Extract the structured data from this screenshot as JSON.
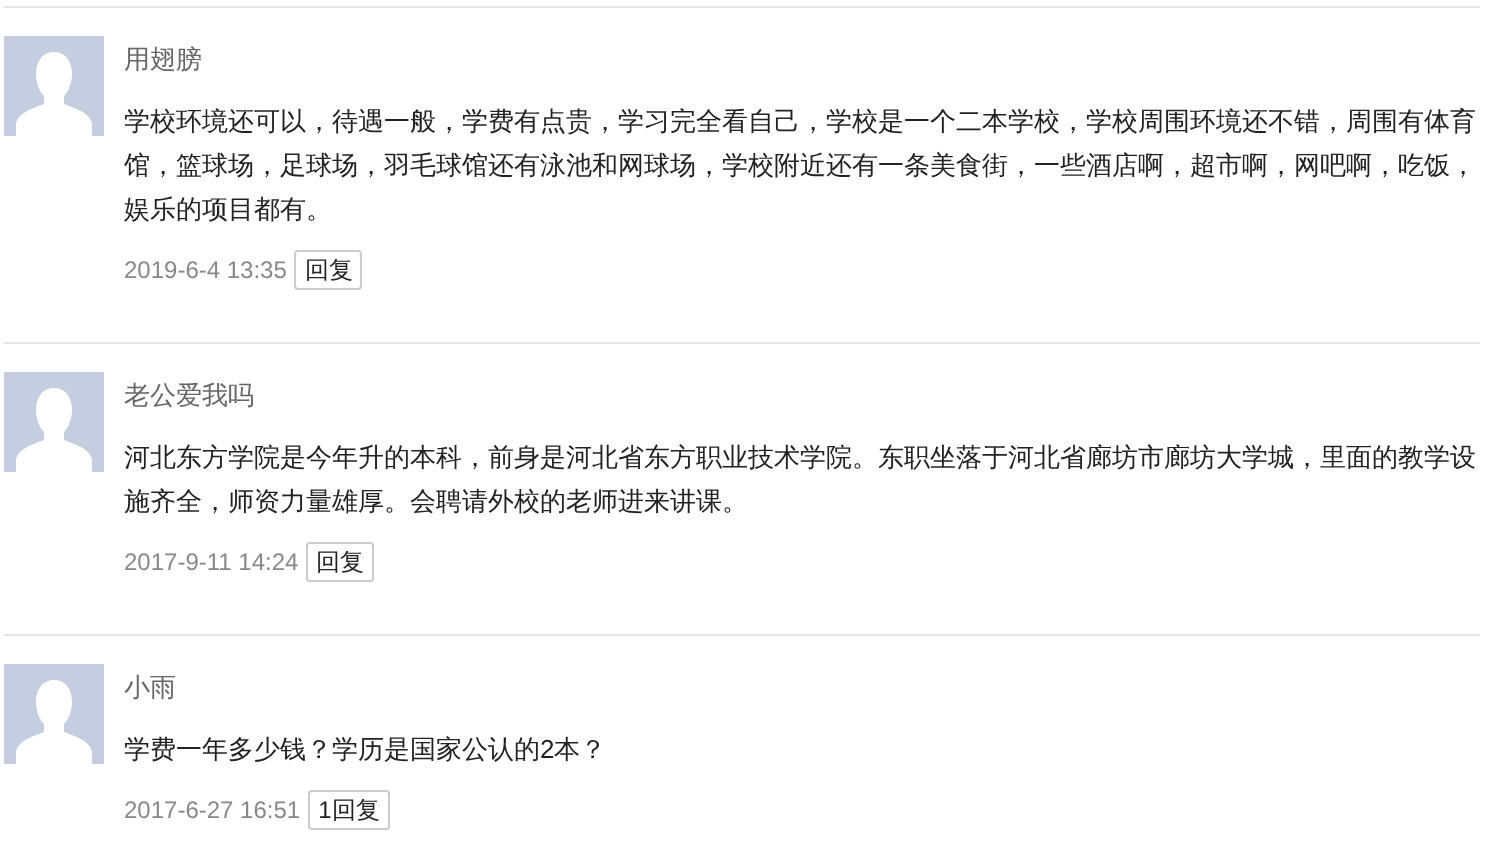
{
  "comments": [
    {
      "author": "用翅膀",
      "text": "学校环境还可以，待遇一般，学费有点贵，学习完全看自己，学校是一个二本学校，学校周围环境还不错，周围有体育馆，篮球场，足球场，羽毛球馆还有泳池和网球场，学校附近还有一条美食街，一些酒店啊，超市啊，网吧啊，吃饭，娱乐的项目都有。",
      "time": "2019-6-4 13:35",
      "reply": "回复"
    },
    {
      "author": "老公爱我吗",
      "text": "河北东方学院是今年升的本科，前身是河北省东方职业技术学院。东职坐落于河北省廊坊市廊坊大学城，里面的教学设施齐全，师资力量雄厚。会聘请外校的老师进来讲课。",
      "time": "2017-9-11 14:24",
      "reply": "回复"
    },
    {
      "author": "小雨",
      "text": "学费一年多少钱？学历是国家公认的2本？",
      "time": "2017-6-27 16:51",
      "reply": "1回复"
    }
  ]
}
